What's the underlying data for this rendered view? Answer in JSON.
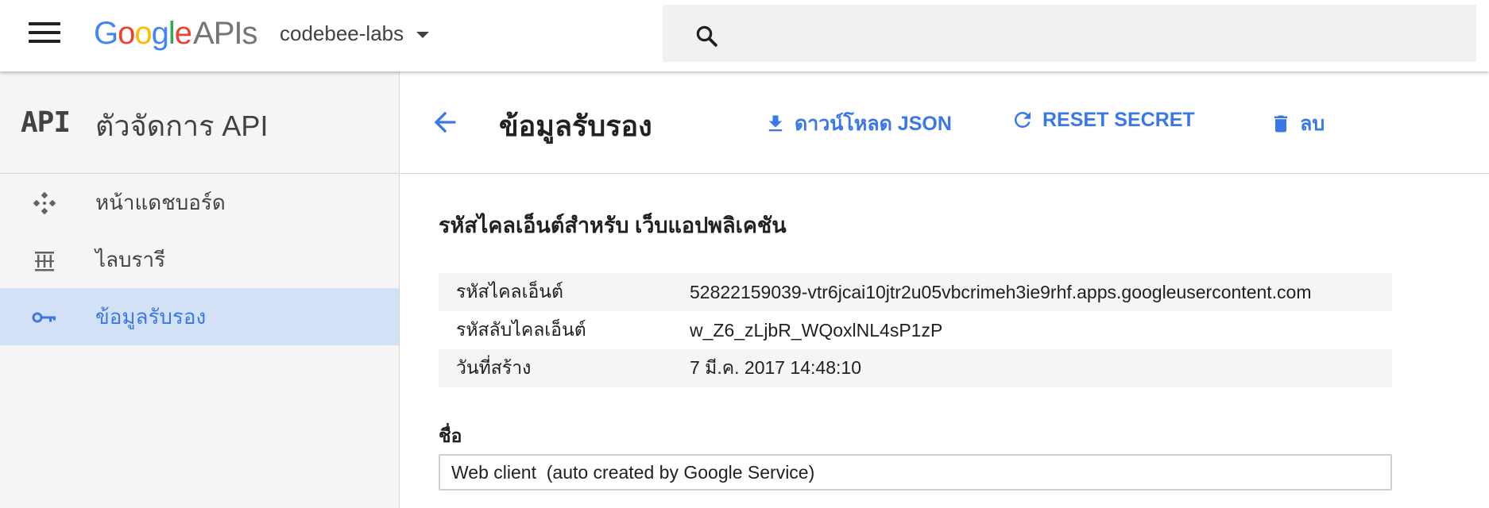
{
  "topbar": {
    "logo_google": [
      "G",
      "o",
      "o",
      "g",
      "l",
      "e"
    ],
    "logo_apis": "APIs",
    "project_name": "codebee-labs",
    "search_placeholder": ""
  },
  "sidebar": {
    "mark": "API",
    "title": "ตัวจัดการ API",
    "items": [
      {
        "label": "หน้าแดชบอร์ด",
        "icon": "dashboard-icon",
        "active": false
      },
      {
        "label": "ไลบรารี",
        "icon": "library-icon",
        "active": false
      },
      {
        "label": "ข้อมูลรับรอง",
        "icon": "key-icon",
        "active": true
      }
    ]
  },
  "header": {
    "title": "ข้อมูลรับรอง",
    "actions": {
      "download": "ดาวน์โหลด JSON",
      "reset": "RESET SECRET",
      "delete": "ลบ"
    }
  },
  "content": {
    "section_title": "รหัสไคลเอ็นต์สำหรับ เว็บแอปพลิเคชัน",
    "rows": [
      {
        "key": "รหัสไคลเอ็นต์",
        "value": "52822159039-vtr6jcai10jtr2u05vbcrimeh3ie9rhf.apps.googleusercontent.com"
      },
      {
        "key": "รหัสลับไคลเอ็นต์",
        "value": "w_Z6_zLjbR_WQoxlNL4sP1zP"
      },
      {
        "key": "วันที่สร้าง",
        "value": "7 มี.ค. 2017 14:48:10"
      }
    ],
    "name_label": "ชื่อ",
    "name_value": "Web client  (auto created by Google Service)"
  },
  "colors": {
    "accent": "#3b78e7",
    "active_bg": "#d3e1f6",
    "sidebar_bg": "#f5f5f5"
  }
}
